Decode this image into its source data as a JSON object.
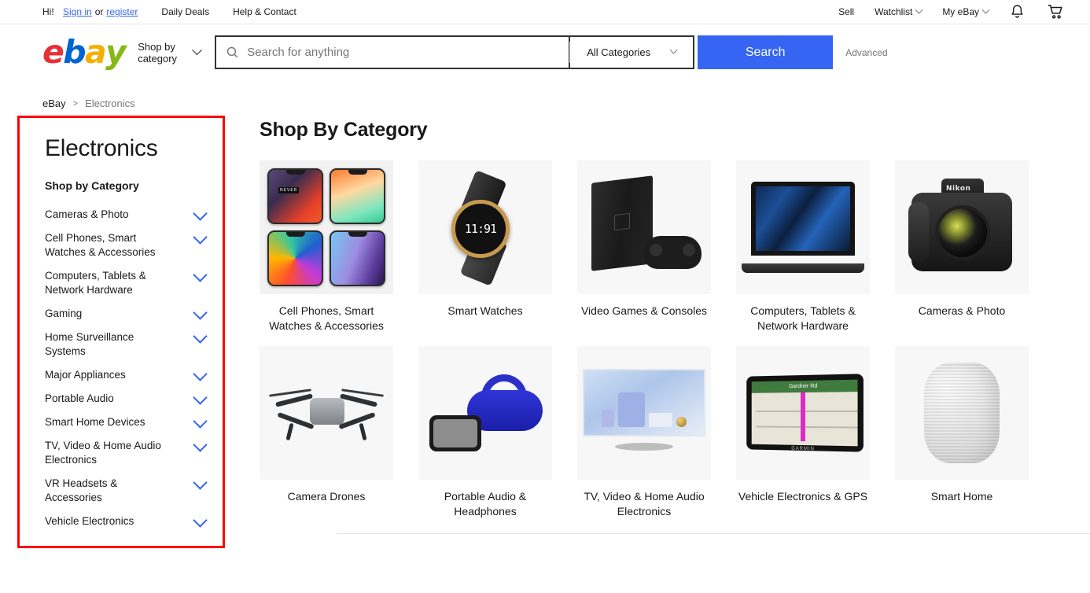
{
  "topbar": {
    "greeting": "Hi!",
    "sign_in": "Sign in",
    "or": "or",
    "register": "register",
    "links": [
      "Daily Deals",
      "Help & Contact"
    ],
    "right_links": [
      "Sell",
      "Watchlist",
      "My eBay"
    ],
    "icons": [
      "bell-icon",
      "cart-icon"
    ]
  },
  "header": {
    "logo": {
      "e": "e",
      "b": "b",
      "a": "a",
      "y": "y"
    },
    "shop_by_category": "Shop by category",
    "search_placeholder": "Search for anything",
    "search_value": "",
    "category_selected": "All Categories",
    "search_button": "Search",
    "advanced": "Advanced"
  },
  "breadcrumb": {
    "root": "eBay",
    "separator": ">",
    "current": "Electronics"
  },
  "sidebar": {
    "title": "Electronics",
    "subtitle": "Shop by Category",
    "highlight_color": "#ff0000",
    "items": [
      {
        "label": "Cameras & Photo"
      },
      {
        "label": "Cell Phones, Smart Watches & Accessories"
      },
      {
        "label": "Computers, Tablets & Network Hardware"
      },
      {
        "label": "Gaming"
      },
      {
        "label": "Home Surveillance Systems"
      },
      {
        "label": "Major Appliances"
      },
      {
        "label": "Portable Audio"
      },
      {
        "label": "Smart Home Devices"
      },
      {
        "label": "TV, Video & Home Audio Electronics"
      },
      {
        "label": "VR Headsets & Accessories"
      },
      {
        "label": "Vehicle Electronics"
      }
    ]
  },
  "main": {
    "title": "Shop By Category",
    "tiles": [
      {
        "label": "Cell Phones, Smart Watches & Accessories",
        "art": "phones"
      },
      {
        "label": "Smart Watches",
        "art": "watch"
      },
      {
        "label": "Video Games & Consoles",
        "art": "console"
      },
      {
        "label": "Computers, Tablets & Network Hardware",
        "art": "laptop"
      },
      {
        "label": "Cameras & Photo",
        "art": "camera"
      },
      {
        "label": "Camera Drones",
        "art": "drone"
      },
      {
        "label": "Portable Audio & Headphones",
        "art": "speakers"
      },
      {
        "label": "TV, Video & Home Audio Electronics",
        "art": "tv"
      },
      {
        "label": "Vehicle Electronics & GPS",
        "art": "gps"
      },
      {
        "label": "Smart Home",
        "art": "homepod"
      }
    ]
  },
  "tile_art": {
    "watch_time": "11:91",
    "camera_brand": "Nikon",
    "gps_street": "Gardner Rd",
    "gps_brand": "GARMIN"
  },
  "colors": {
    "accent_blue": "#3665f3",
    "logo_red": "#e53238",
    "logo_blue": "#0064d2",
    "logo_yellow": "#f5af02",
    "logo_green": "#86b817",
    "highlight_red": "#ff0000"
  }
}
